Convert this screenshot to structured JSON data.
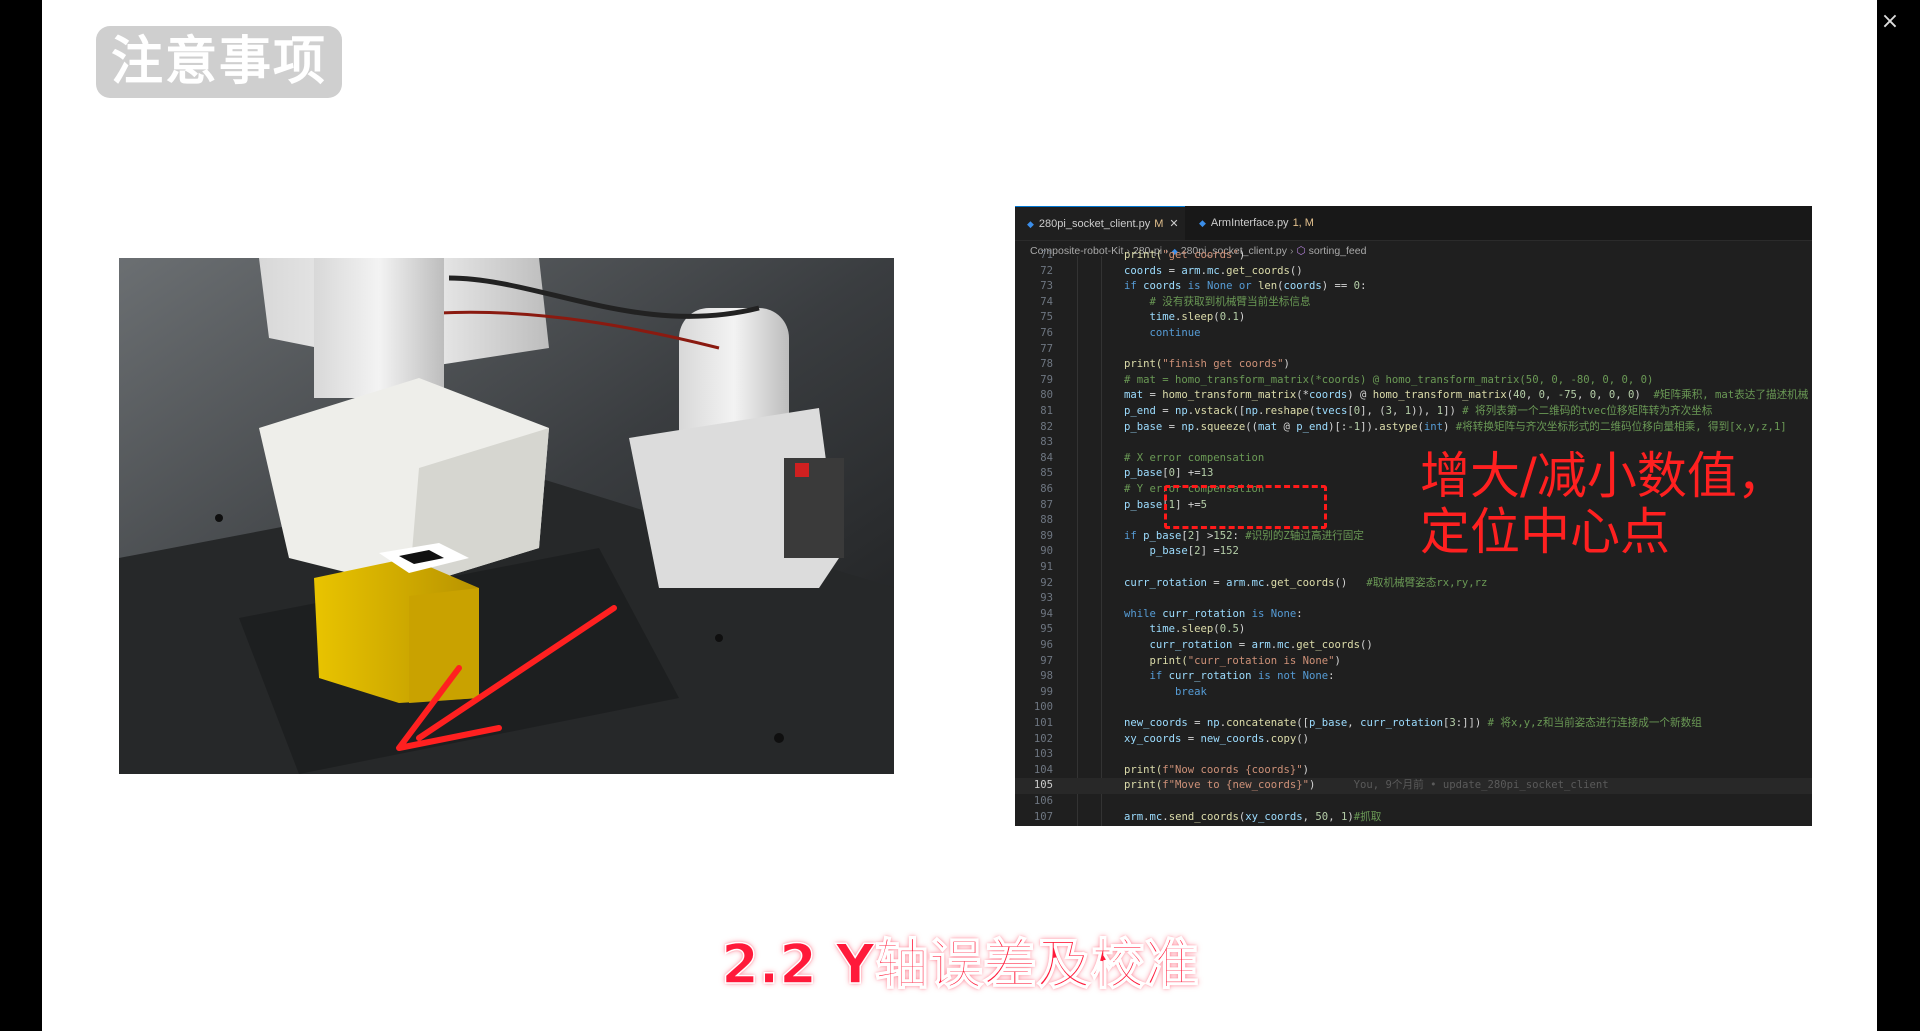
{
  "window": {
    "close_glyph": "×"
  },
  "slide": {
    "tag": "注意事项",
    "subtitle": "2.2 Y轴误差及校准",
    "annotation": [
      "增大/减小数值，",
      "定位中心点"
    ]
  },
  "photo": {
    "icon": "robot-arm-photo",
    "arrow_color": "#ff2222"
  },
  "editor": {
    "tabs": [
      {
        "label": "280pi_socket_client.py",
        "status": "M",
        "active": true
      },
      {
        "label": "ArmInterface.py",
        "status": "1, M",
        "active": false
      }
    ],
    "breadcrumb": [
      "Composite-robot-Kit",
      "280-pi",
      "280pi_socket_client.py",
      "sorting_feed"
    ],
    "current_line": "105",
    "lines": [
      {
        "n": "71",
        "ind": 2,
        "t": [
          [
            "print(",
            "fn"
          ],
          [
            "\"get coords\"",
            "st"
          ],
          [
            ")",
            ""
          ]
        ]
      },
      {
        "n": "72",
        "ind": 2,
        "t": [
          [
            "coords",
            "var"
          ],
          [
            " = ",
            ""
          ],
          [
            "arm",
            "var"
          ],
          [
            ".",
            ""
          ],
          [
            "mc",
            "var"
          ],
          [
            ".",
            ""
          ],
          [
            "get_coords",
            "fn"
          ],
          [
            "()",
            ""
          ]
        ]
      },
      {
        "n": "73",
        "ind": 2,
        "t": [
          [
            "if ",
            "kw"
          ],
          [
            "coords",
            "var"
          ],
          [
            " is ",
            "kw"
          ],
          [
            "None",
            "kw"
          ],
          [
            " or ",
            "kw"
          ],
          [
            "len",
            "fn"
          ],
          [
            "(",
            ""
          ],
          [
            "coords",
            "var"
          ],
          [
            ") == ",
            ""
          ],
          [
            "0",
            "nm"
          ],
          [
            ":",
            ""
          ]
        ]
      },
      {
        "n": "74",
        "ind": 3,
        "t": [
          [
            "# 没有获取到机械臂当前坐标信息",
            "cm"
          ]
        ]
      },
      {
        "n": "75",
        "ind": 3,
        "t": [
          [
            "time",
            "var"
          ],
          [
            ".",
            ""
          ],
          [
            "sleep",
            "fn"
          ],
          [
            "(",
            ""
          ],
          [
            "0.1",
            "nm"
          ],
          [
            ")",
            ""
          ]
        ]
      },
      {
        "n": "76",
        "ind": 3,
        "t": [
          [
            "continue",
            "kw"
          ]
        ]
      },
      {
        "n": "77",
        "ind": 0,
        "t": []
      },
      {
        "n": "78",
        "ind": 2,
        "t": [
          [
            "print(",
            "fn"
          ],
          [
            "\"finish get coords\"",
            "st"
          ],
          [
            ")",
            ""
          ]
        ]
      },
      {
        "n": "79",
        "ind": 2,
        "t": [
          [
            "# mat = homo_transform_matrix(*coords) @ homo_transform_matrix(50, 0, -80, 0, 0, 0)",
            "cm"
          ]
        ]
      },
      {
        "n": "80",
        "ind": 2,
        "t": [
          [
            "mat",
            "var"
          ],
          [
            " = ",
            ""
          ],
          [
            "homo_transform_matrix",
            "fn"
          ],
          [
            "(*",
            ""
          ],
          [
            "coords",
            "var"
          ],
          [
            ") @ ",
            ""
          ],
          [
            "homo_transform_matrix",
            "fn"
          ],
          [
            "(",
            ""
          ],
          [
            "40",
            "nm"
          ],
          [
            ", ",
            ""
          ],
          [
            "0",
            "nm"
          ],
          [
            ", ",
            ""
          ],
          [
            "-75",
            "nm"
          ],
          [
            ", ",
            ""
          ],
          [
            "0",
            "nm"
          ],
          [
            ", ",
            ""
          ],
          [
            "0",
            "nm"
          ],
          [
            ", ",
            ""
          ],
          [
            "0",
            "nm"
          ],
          [
            ")  ",
            ""
          ],
          [
            "#矩阵乘积, mat表达了描述机械",
            "cm"
          ]
        ]
      },
      {
        "n": "81",
        "ind": 2,
        "t": [
          [
            "p_end",
            "var"
          ],
          [
            " = ",
            ""
          ],
          [
            "np",
            "var"
          ],
          [
            ".",
            ""
          ],
          [
            "vstack",
            "fn"
          ],
          [
            "([",
            ""
          ],
          [
            "np",
            "var"
          ],
          [
            ".",
            ""
          ],
          [
            "reshape",
            "fn"
          ],
          [
            "(",
            ""
          ],
          [
            "tvecs",
            "var"
          ],
          [
            "[",
            ""
          ],
          [
            "0",
            "nm"
          ],
          [
            "], (",
            ""
          ],
          [
            "3",
            "nm"
          ],
          [
            ", ",
            ""
          ],
          [
            "1",
            "nm"
          ],
          [
            ")), ",
            ""
          ],
          [
            "1",
            "nm"
          ],
          [
            "]) ",
            ""
          ],
          [
            "# 将列表第一个二维码的tvec位移矩阵转为齐次坐标",
            "cm"
          ]
        ]
      },
      {
        "n": "82",
        "ind": 2,
        "t": [
          [
            "p_base",
            "var"
          ],
          [
            " = ",
            ""
          ],
          [
            "np",
            "var"
          ],
          [
            ".",
            ""
          ],
          [
            "squeeze",
            "fn"
          ],
          [
            "((",
            ""
          ],
          [
            "mat",
            "var"
          ],
          [
            " @ ",
            ""
          ],
          [
            "p_end",
            "var"
          ],
          [
            ")[:",
            ""
          ],
          [
            "-1",
            "nm"
          ],
          [
            "]).",
            ""
          ],
          [
            "astype",
            "fn"
          ],
          [
            "(",
            ""
          ],
          [
            "int",
            "kw"
          ],
          [
            ") ",
            ""
          ],
          [
            "#将转换矩阵与齐次坐标形式的二维码位移向量相乘, 得到[x,y,z,1]",
            "cm"
          ]
        ]
      },
      {
        "n": "83",
        "ind": 0,
        "t": []
      },
      {
        "n": "84",
        "ind": 2,
        "t": [
          [
            "# X error compensation",
            "cm"
          ]
        ]
      },
      {
        "n": "85",
        "ind": 2,
        "t": [
          [
            "p_base",
            "var"
          ],
          [
            "[",
            ""
          ],
          [
            "0",
            "nm"
          ],
          [
            "] +=",
            ""
          ],
          [
            "13",
            "nm"
          ]
        ]
      },
      {
        "n": "86",
        "ind": 2,
        "t": [
          [
            "# Y error compensation",
            "cm"
          ]
        ]
      },
      {
        "n": "87",
        "ind": 2,
        "t": [
          [
            "p_base",
            "var"
          ],
          [
            "[",
            ""
          ],
          [
            "1",
            "nm"
          ],
          [
            "] +=",
            ""
          ],
          [
            "5",
            "nm"
          ]
        ]
      },
      {
        "n": "88",
        "ind": 0,
        "t": []
      },
      {
        "n": "89",
        "ind": 2,
        "t": [
          [
            "if ",
            "kw"
          ],
          [
            "p_base",
            "var"
          ],
          [
            "[",
            ""
          ],
          [
            "2",
            "nm"
          ],
          [
            "] >",
            ""
          ],
          [
            "152",
            "nm"
          ],
          [
            ": ",
            ""
          ],
          [
            "#识别的Z轴过高进行固定",
            "cm"
          ]
        ]
      },
      {
        "n": "90",
        "ind": 3,
        "t": [
          [
            "p_base",
            "var"
          ],
          [
            "[",
            ""
          ],
          [
            "2",
            "nm"
          ],
          [
            "] =",
            ""
          ],
          [
            "152",
            "nm"
          ]
        ]
      },
      {
        "n": "91",
        "ind": 0,
        "t": []
      },
      {
        "n": "92",
        "ind": 2,
        "t": [
          [
            "curr_rotation",
            "var"
          ],
          [
            " = ",
            ""
          ],
          [
            "arm",
            "var"
          ],
          [
            ".",
            ""
          ],
          [
            "mc",
            "var"
          ],
          [
            ".",
            ""
          ],
          [
            "get_coords",
            "fn"
          ],
          [
            "()   ",
            ""
          ],
          [
            "#取机械臂姿态rx,ry,rz",
            "cm"
          ]
        ]
      },
      {
        "n": "93",
        "ind": 0,
        "t": []
      },
      {
        "n": "94",
        "ind": 2,
        "t": [
          [
            "while ",
            "kw"
          ],
          [
            "curr_rotation",
            "var"
          ],
          [
            " is ",
            "kw"
          ],
          [
            "None",
            "kw"
          ],
          [
            ":",
            ""
          ]
        ]
      },
      {
        "n": "95",
        "ind": 3,
        "t": [
          [
            "time",
            "var"
          ],
          [
            ".",
            ""
          ],
          [
            "sleep",
            "fn"
          ],
          [
            "(",
            ""
          ],
          [
            "0.5",
            "nm"
          ],
          [
            ")",
            ""
          ]
        ]
      },
      {
        "n": "96",
        "ind": 3,
        "t": [
          [
            "curr_rotation",
            "var"
          ],
          [
            " = ",
            ""
          ],
          [
            "arm",
            "var"
          ],
          [
            ".",
            ""
          ],
          [
            "mc",
            "var"
          ],
          [
            ".",
            ""
          ],
          [
            "get_coords",
            "fn"
          ],
          [
            "()",
            ""
          ]
        ]
      },
      {
        "n": "97",
        "ind": 3,
        "t": [
          [
            "print(",
            "fn"
          ],
          [
            "\"curr_rotation is None\"",
            "st"
          ],
          [
            ")",
            ""
          ]
        ]
      },
      {
        "n": "98",
        "ind": 3,
        "t": [
          [
            "if ",
            "kw"
          ],
          [
            "curr_rotation",
            "var"
          ],
          [
            " is not ",
            "kw"
          ],
          [
            "None",
            "kw"
          ],
          [
            ":",
            ""
          ]
        ]
      },
      {
        "n": "99",
        "ind": 4,
        "t": [
          [
            "break",
            "kw"
          ]
        ]
      },
      {
        "n": "100",
        "ind": 0,
        "t": []
      },
      {
        "n": "101",
        "ind": 2,
        "t": [
          [
            "new_coords",
            "var"
          ],
          [
            " = ",
            ""
          ],
          [
            "np",
            "var"
          ],
          [
            ".",
            ""
          ],
          [
            "concatenate",
            "fn"
          ],
          [
            "([",
            ""
          ],
          [
            "p_base",
            "var"
          ],
          [
            ", ",
            ""
          ],
          [
            "curr_rotation",
            "var"
          ],
          [
            "[",
            ""
          ],
          [
            "3",
            "nm"
          ],
          [
            ":]]) ",
            ""
          ],
          [
            "# 将x,y,z和当前姿态进行连接成一个新数组",
            "cm"
          ]
        ]
      },
      {
        "n": "102",
        "ind": 2,
        "t": [
          [
            "xy_coords",
            "var"
          ],
          [
            " = ",
            ""
          ],
          [
            "new_coords",
            "var"
          ],
          [
            ".",
            ""
          ],
          [
            "copy",
            "fn"
          ],
          [
            "()",
            ""
          ]
        ]
      },
      {
        "n": "103",
        "ind": 0,
        "t": []
      },
      {
        "n": "104",
        "ind": 2,
        "t": [
          [
            "print(",
            "fn"
          ],
          [
            "f\"Now coords {coords}\"",
            "st"
          ],
          [
            ")",
            ""
          ]
        ]
      },
      {
        "n": "105",
        "ind": 2,
        "t": [
          [
            "print(",
            "fn"
          ],
          [
            "f\"Move to {new_coords}\"",
            "st"
          ],
          [
            ")      ",
            ""
          ],
          [
            "You, 9个月前 • update_280pi_socket_client",
            "blame"
          ]
        ]
      },
      {
        "n": "106",
        "ind": 0,
        "t": []
      },
      {
        "n": "107",
        "ind": 2,
        "t": [
          [
            "arm",
            "var"
          ],
          [
            ".",
            ""
          ],
          [
            "mc",
            "var"
          ],
          [
            ".",
            ""
          ],
          [
            "send_coords",
            "fn"
          ],
          [
            "(",
            ""
          ],
          [
            "xy_coords",
            "var"
          ],
          [
            ", ",
            ""
          ],
          [
            "50",
            "nm"
          ],
          [
            ", ",
            ""
          ],
          [
            "1",
            "nm"
          ],
          [
            ")",
            ""
          ],
          [
            "#抓取",
            "cm"
          ]
        ]
      }
    ]
  }
}
